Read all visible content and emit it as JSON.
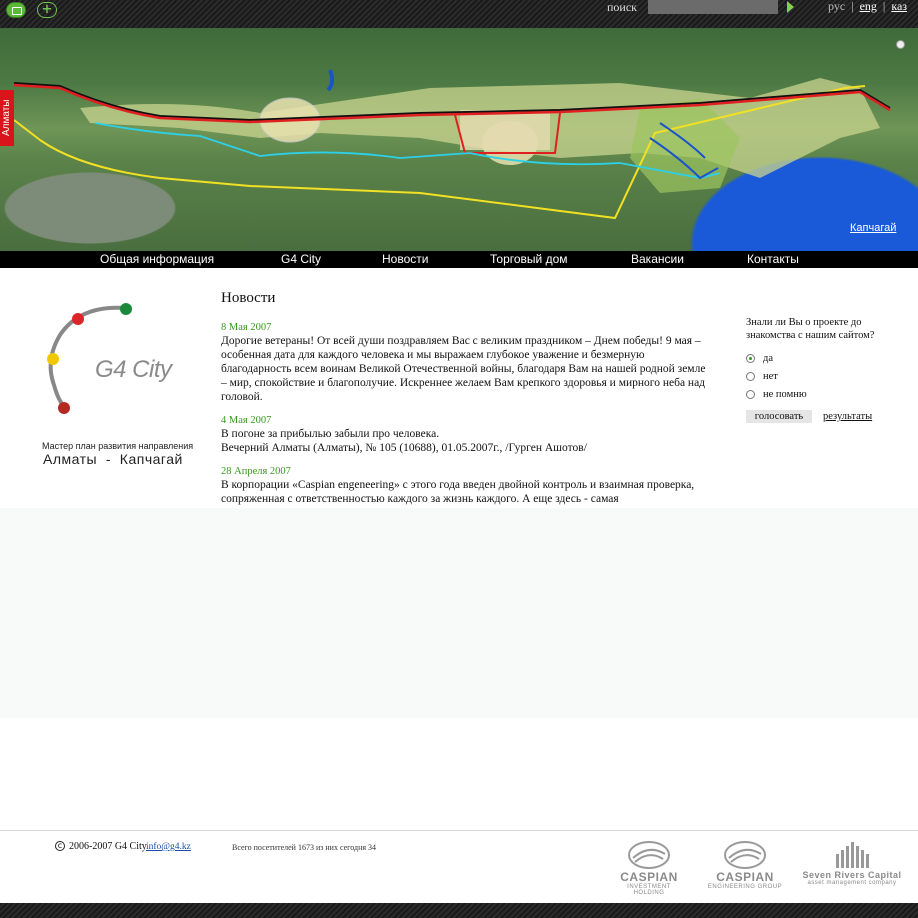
{
  "topbar": {
    "search_label": "поиск",
    "search_value": "",
    "langs": [
      "рус",
      "eng",
      "каз"
    ],
    "selected_lang": "eng",
    "separator": "|"
  },
  "map": {
    "side_label": "Алматы",
    "link": "Капчагай"
  },
  "nav": {
    "items": [
      "Общая информация",
      "G4 City",
      "Новости",
      "Торговый дом",
      "Вакансии",
      "Контакты"
    ]
  },
  "logo": {
    "title": "G4 City",
    "tagline": "Мастер план развития направления",
    "cities": "Алматы  -  Капчагай",
    "dot_colors": [
      "#1a8a3a",
      "#d9262a",
      "#f0c800",
      "#b22a22"
    ]
  },
  "news": {
    "heading": "Новости",
    "items": [
      {
        "date": "8 Мая 2007",
        "text": "Дорогие ветераны!  От всей души поздравляем Вас с великим праздником –  Днем победы! 9 мая – особенная дата для каждого человека и мы выражаем глубокое  уважение и безмерную благодарность всем воинам Великой Отечественной войны, благодаря Вам на нашей родной земле – мир, спокойствие и благополучие. Искреннее желаем Вам крепкого здоровья и мирного неба над головой."
      },
      {
        "date": "4 Мая 2007",
        "text": "В погоне за прибылью забыли про человека.",
        "text2": "Вечерний Алматы (Алматы), № 105 (10688), 01.05.2007г., /Гурген Ашотов/"
      },
      {
        "date": "28 Апреля 2007",
        "text": "В корпорации «Caspian engeneering» с этого года введен двойной контроль и взаимная проверка, сопряженная с ответственностью каждого за жизнь каждого. А еще здесь - самая"
      }
    ]
  },
  "poll": {
    "question": "Знали ли Вы о проекте до знакомства с нашим сайтом?",
    "options": [
      "да",
      "нет",
      "не помню"
    ],
    "selected": 0,
    "vote_label": "голосовать",
    "results_label": "результаты"
  },
  "footer": {
    "copyright": "2006-2007 G4 City",
    "email": "info@g4.kz",
    "visitors": "Всего посетителей 1673  из них сегодня  34",
    "partners": [
      {
        "name": "CASPIAN",
        "sub": "INVESTMENT HOLDING"
      },
      {
        "name": "CASPIAN",
        "sub": "ENGINEERING GROUP"
      },
      {
        "name": "Seven Rivers Capital",
        "sub": "asset management company"
      }
    ]
  },
  "colors": {
    "accent_green": "#3a9a20",
    "nav_bg": "#000000",
    "lake": "#1a5ad8"
  }
}
